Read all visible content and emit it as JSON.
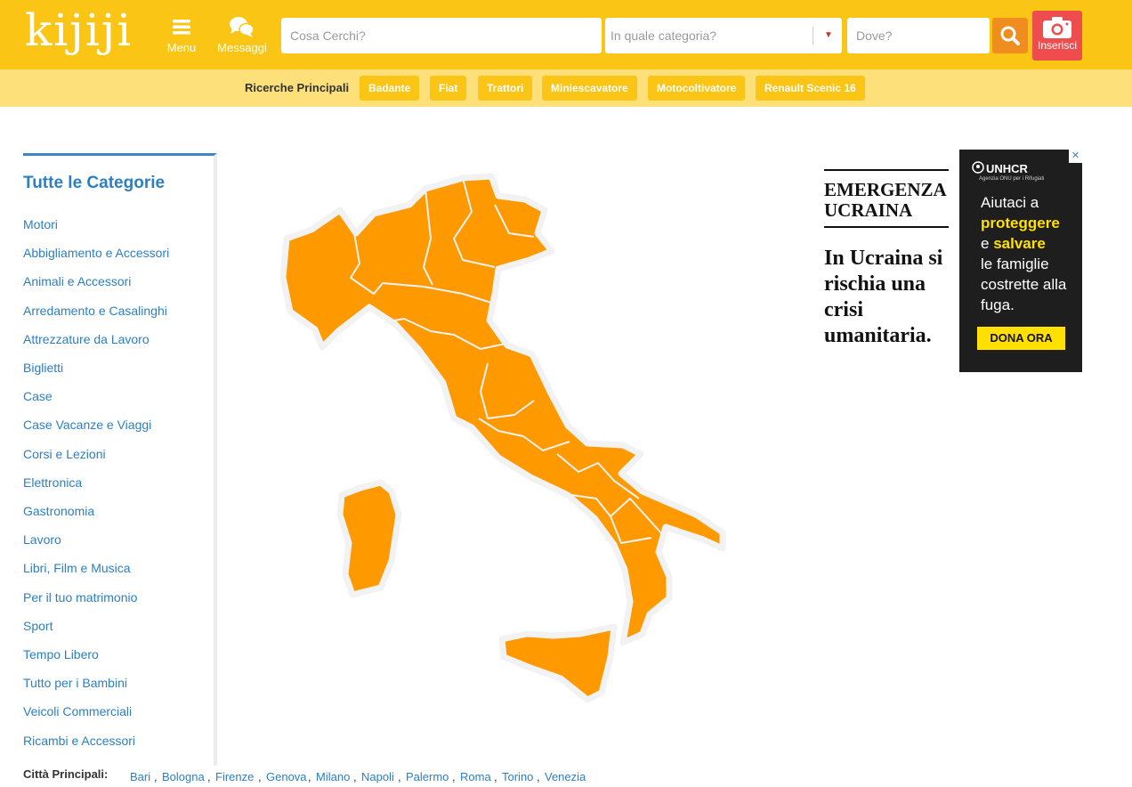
{
  "header": {
    "logo": "kijiji",
    "menu_label": "Menu",
    "messages_label": "Messaggi",
    "search_placeholder": "Cosa Cerchi?",
    "category_placeholder": "In quale categoria?",
    "where_placeholder": "Dove?",
    "post_label": "Inserisci",
    "accent_color": "#fbc516"
  },
  "top_searches": {
    "label": "Ricerche Principali",
    "items": [
      "Badante",
      "Fiat",
      "Trattori",
      "Miniescavatore",
      "Motocoltivatore",
      "Renault Scenic 16"
    ]
  },
  "sidebar": {
    "title": "Tutte le Categorie",
    "items": [
      "Motori",
      "Abbigliamento e Accessori",
      "Animali e Accessori",
      "Arredamento e Casalinghi",
      "Attrezzature da Lavoro",
      "Biglietti",
      "Case",
      "Case Vacanze e Viaggi",
      "Corsi e Lezioni",
      "Elettronica",
      "Gastronomia",
      "Lavoro",
      "Libri, Film e Musica",
      "Per il tuo matrimonio",
      "Sport",
      "Tempo Libero",
      "Tutto per i Bambini",
      "Veicoli Commerciali",
      "Ricambi e Accessori"
    ]
  },
  "ad": {
    "left_title": "EMERGENZA UCRAINA",
    "left_body": "In Ucraina si rischia una crisi umanitaria.",
    "brand": "UNHCR",
    "brand_sub": "Agenzia ONU per i Rifugiati",
    "body_1": "Aiutaci a",
    "body_2": "proteggere",
    "body_3": "e",
    "body_4": "salvare",
    "body_5": "le famiglie costrette alla fuga.",
    "cta": "DONA ORA",
    "close": "✕"
  },
  "cities": {
    "label": "Città Principali:",
    "items": [
      "Bari",
      "Bologna",
      "Firenze",
      "Genova",
      "Milano",
      "Napoli",
      "Palermo",
      "Roma",
      "Torino",
      "Venezia"
    ]
  }
}
